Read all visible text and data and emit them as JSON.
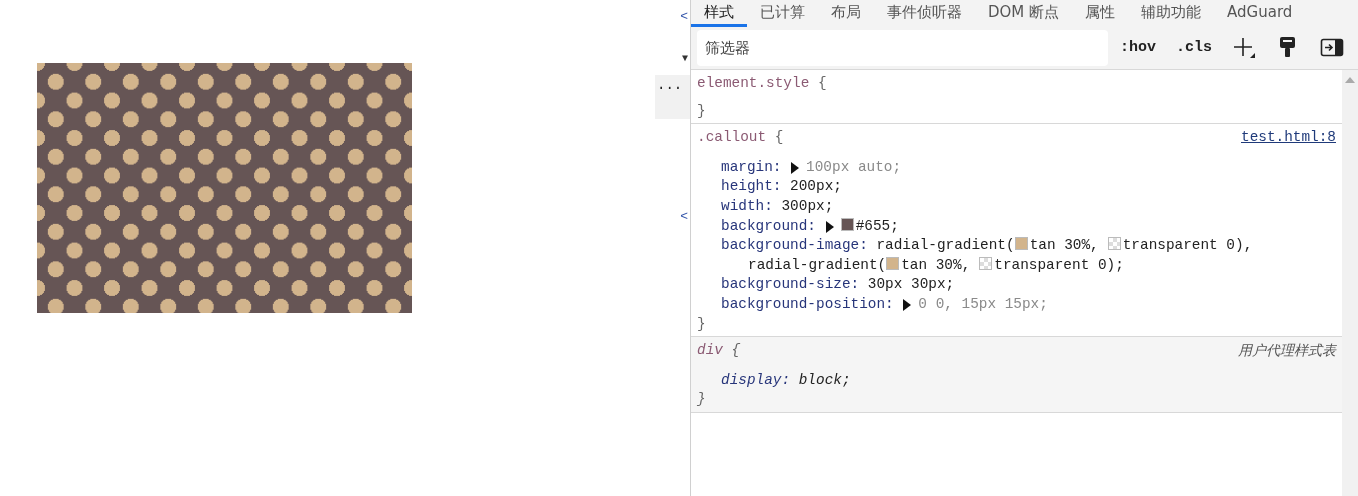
{
  "elements_strip": {
    "marks": [
      {
        "text": "<",
        "kind": "tag"
      },
      {
        "text": "▼",
        "kind": "toggle"
      },
      {
        "text": "<",
        "kind": "tag"
      }
    ],
    "ellipsis": "..."
  },
  "tabs": [
    {
      "label": "样式",
      "selected": true
    },
    {
      "label": "已计算",
      "selected": false
    },
    {
      "label": "布局",
      "selected": false
    },
    {
      "label": "事件侦听器",
      "selected": false
    },
    {
      "label": "DOM 断点",
      "selected": false
    },
    {
      "label": "属性",
      "selected": false
    },
    {
      "label": "辅助功能",
      "selected": false
    },
    {
      "label": "AdGuard",
      "selected": false
    }
  ],
  "toolbar": {
    "filter": {
      "placeholder": "筛选器"
    },
    "buttons": [
      {
        "kind": "text",
        "label": ":hov"
      },
      {
        "kind": "text",
        "label": ".cls"
      },
      {
        "kind": "add"
      },
      {
        "kind": "brush"
      },
      {
        "kind": "sidebar"
      }
    ]
  },
  "rules": [
    {
      "kind": "inline",
      "selector": "element.style",
      "open": "{",
      "close": "}"
    },
    {
      "kind": "author",
      "selector": ".callout",
      "open": "{",
      "close": "}",
      "source": "test.html:8",
      "declarations": [
        {
          "property": "margin:",
          "lines": [
            [
              {
                "kind": "arrow"
              },
              {
                "kind": "text",
                "text": "100px auto;",
                "muted": true
              }
            ]
          ]
        },
        {
          "property": "height:",
          "lines": [
            [
              {
                "kind": "text",
                "text": "200px;",
                "muted": false
              }
            ]
          ]
        },
        {
          "property": "width:",
          "lines": [
            [
              {
                "kind": "text",
                "text": "300px;",
                "muted": false
              }
            ]
          ]
        },
        {
          "property": "background:",
          "lines": [
            [
              {
                "kind": "arrow"
              },
              {
                "kind": "swatch",
                "color": "#665555"
              },
              {
                "kind": "text",
                "text": "#655;",
                "muted": false
              }
            ]
          ]
        },
        {
          "property": "background-image:",
          "lines": [
            [
              {
                "kind": "text",
                "text": "radial-gradient(",
                "muted": false
              },
              {
                "kind": "swatch",
                "color": "#d2b48c"
              },
              {
                "kind": "text",
                "text": "tan 30%,",
                "muted": false
              },
              {
                "kind": "checker"
              },
              {
                "kind": "text",
                "text": "transparent 0),",
                "muted": false
              }
            ],
            [
              {
                "kind": "text",
                "text": "radial-gradient(",
                "muted": false
              },
              {
                "kind": "swatch",
                "color": "#d2b48c"
              },
              {
                "kind": "text",
                "text": "tan 30%,",
                "muted": false
              },
              {
                "kind": "checker"
              },
              {
                "kind": "text",
                "text": "transparent 0);",
                "muted": false
              }
            ]
          ]
        },
        {
          "property": "background-size:",
          "lines": [
            [
              {
                "kind": "text",
                "text": "30px 30px;",
                "muted": false
              }
            ]
          ]
        },
        {
          "property": "background-position:",
          "lines": [
            [
              {
                "kind": "arrow"
              },
              {
                "kind": "text",
                "text": "0 0, 15px 15px;",
                "muted": true
              }
            ]
          ]
        }
      ]
    },
    {
      "kind": "user-agent",
      "selector": "div",
      "open": "{",
      "close": "}",
      "source": "用户代理样式表",
      "declarations": [
        {
          "property": "display:",
          "lines": [
            [
              {
                "kind": "text",
                "text": "block;",
                "muted": false
              }
            ]
          ]
        }
      ]
    }
  ]
}
